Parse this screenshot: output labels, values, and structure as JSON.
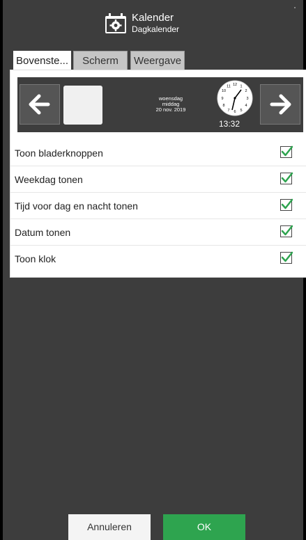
{
  "header": {
    "title": "Kalender",
    "subtitle": "Dagkalender",
    "icon": "calendar-gear-icon"
  },
  "tabs": [
    {
      "label": "Bovenste...",
      "active": true
    },
    {
      "label": "Scherm",
      "active": false
    },
    {
      "label": "Weergave",
      "active": false
    }
  ],
  "preview": {
    "weekday": "woensdag",
    "daypart": "middag",
    "date": "20 nov. 2019",
    "time": "13:32",
    "left_icon": "arrow-left-icon",
    "right_icon": "arrow-right-icon",
    "clock_icon": "analog-clock-icon"
  },
  "options": [
    {
      "label": "Toon bladerknoppen",
      "checked": true
    },
    {
      "label": "Weekdag tonen",
      "checked": true
    },
    {
      "label": "Tijd voor dag en nacht tonen",
      "checked": true
    },
    {
      "label": "Datum tonen",
      "checked": true
    },
    {
      "label": "Toon klok",
      "checked": true
    }
  ],
  "footer": {
    "cancel_label": "Annuleren",
    "ok_label": "OK"
  },
  "colors": {
    "accent": "#2ea44f",
    "background": "#3d3d3d",
    "check": "#2ea44f"
  }
}
